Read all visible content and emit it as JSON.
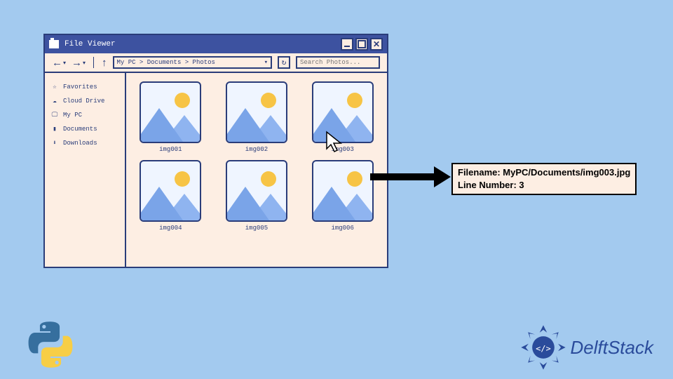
{
  "window": {
    "title": "File Viewer",
    "controls": {
      "minimize": "_",
      "maximize": "□",
      "close": "✕"
    }
  },
  "toolbar": {
    "back": "←",
    "forward": "→",
    "up": "↑",
    "breadcrumb": "My PC > Documents > Photos",
    "refresh": "↻",
    "search_placeholder": "Search Photos..."
  },
  "sidebar": {
    "items": [
      {
        "icon": "star",
        "label": "Favorites"
      },
      {
        "icon": "cloud",
        "label": "Cloud Drive"
      },
      {
        "icon": "laptop",
        "label": "My PC"
      },
      {
        "icon": "folder",
        "label": "Documents"
      },
      {
        "icon": "download",
        "label": "Downloads"
      }
    ]
  },
  "files": [
    {
      "name": "img001"
    },
    {
      "name": "img002"
    },
    {
      "name": "img003"
    },
    {
      "name": "img004"
    },
    {
      "name": "img005"
    },
    {
      "name": "img006"
    }
  ],
  "callout": {
    "line1": "Filename: MyPC/Documents/img003.jpg",
    "line2": "Line Number: 3"
  },
  "logos": {
    "delft": "DelftStack"
  }
}
